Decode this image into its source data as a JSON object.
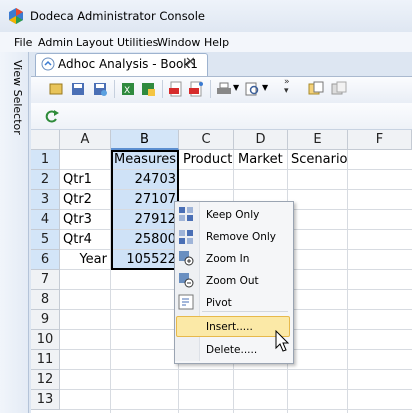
{
  "window": {
    "title": "Dodeca Administrator Console"
  },
  "menu": [
    "File",
    "Admin",
    "Layout",
    "Utilities",
    "Window",
    "Help"
  ],
  "view_selector": {
    "label": "View Selector"
  },
  "tab": {
    "label": "Adhoc Analysis - Book1",
    "close": "✕"
  },
  "grid": {
    "columns": [
      "A",
      "B",
      "C",
      "D",
      "E",
      "F"
    ],
    "rows": [
      "1",
      "2",
      "3",
      "4",
      "5",
      "6",
      "7",
      "8",
      "9",
      "10",
      "11",
      "12",
      "13"
    ],
    "cells": {
      "B1": "Measures",
      "C1": "Product",
      "D1": "Market",
      "E1": "Scenario",
      "A2": "Qtr1",
      "B2": "24703",
      "A3": "Qtr2",
      "B3": "27107",
      "A4": "Qtr3",
      "B4": "27912",
      "A5": "Qtr4",
      "B5": "25800",
      "A6": "Year",
      "B6": "105522"
    }
  },
  "context_menu": {
    "items": [
      "Keep Only",
      "Remove Only",
      "Zoom In",
      "Zoom Out",
      "Pivot",
      "Insert.....",
      "Delete....."
    ],
    "highlighted": "Insert....."
  },
  "colors": {
    "selection": "#cfe2f7",
    "menu_highlight": "#fbe9a7",
    "accent": "#5b8ed0"
  }
}
